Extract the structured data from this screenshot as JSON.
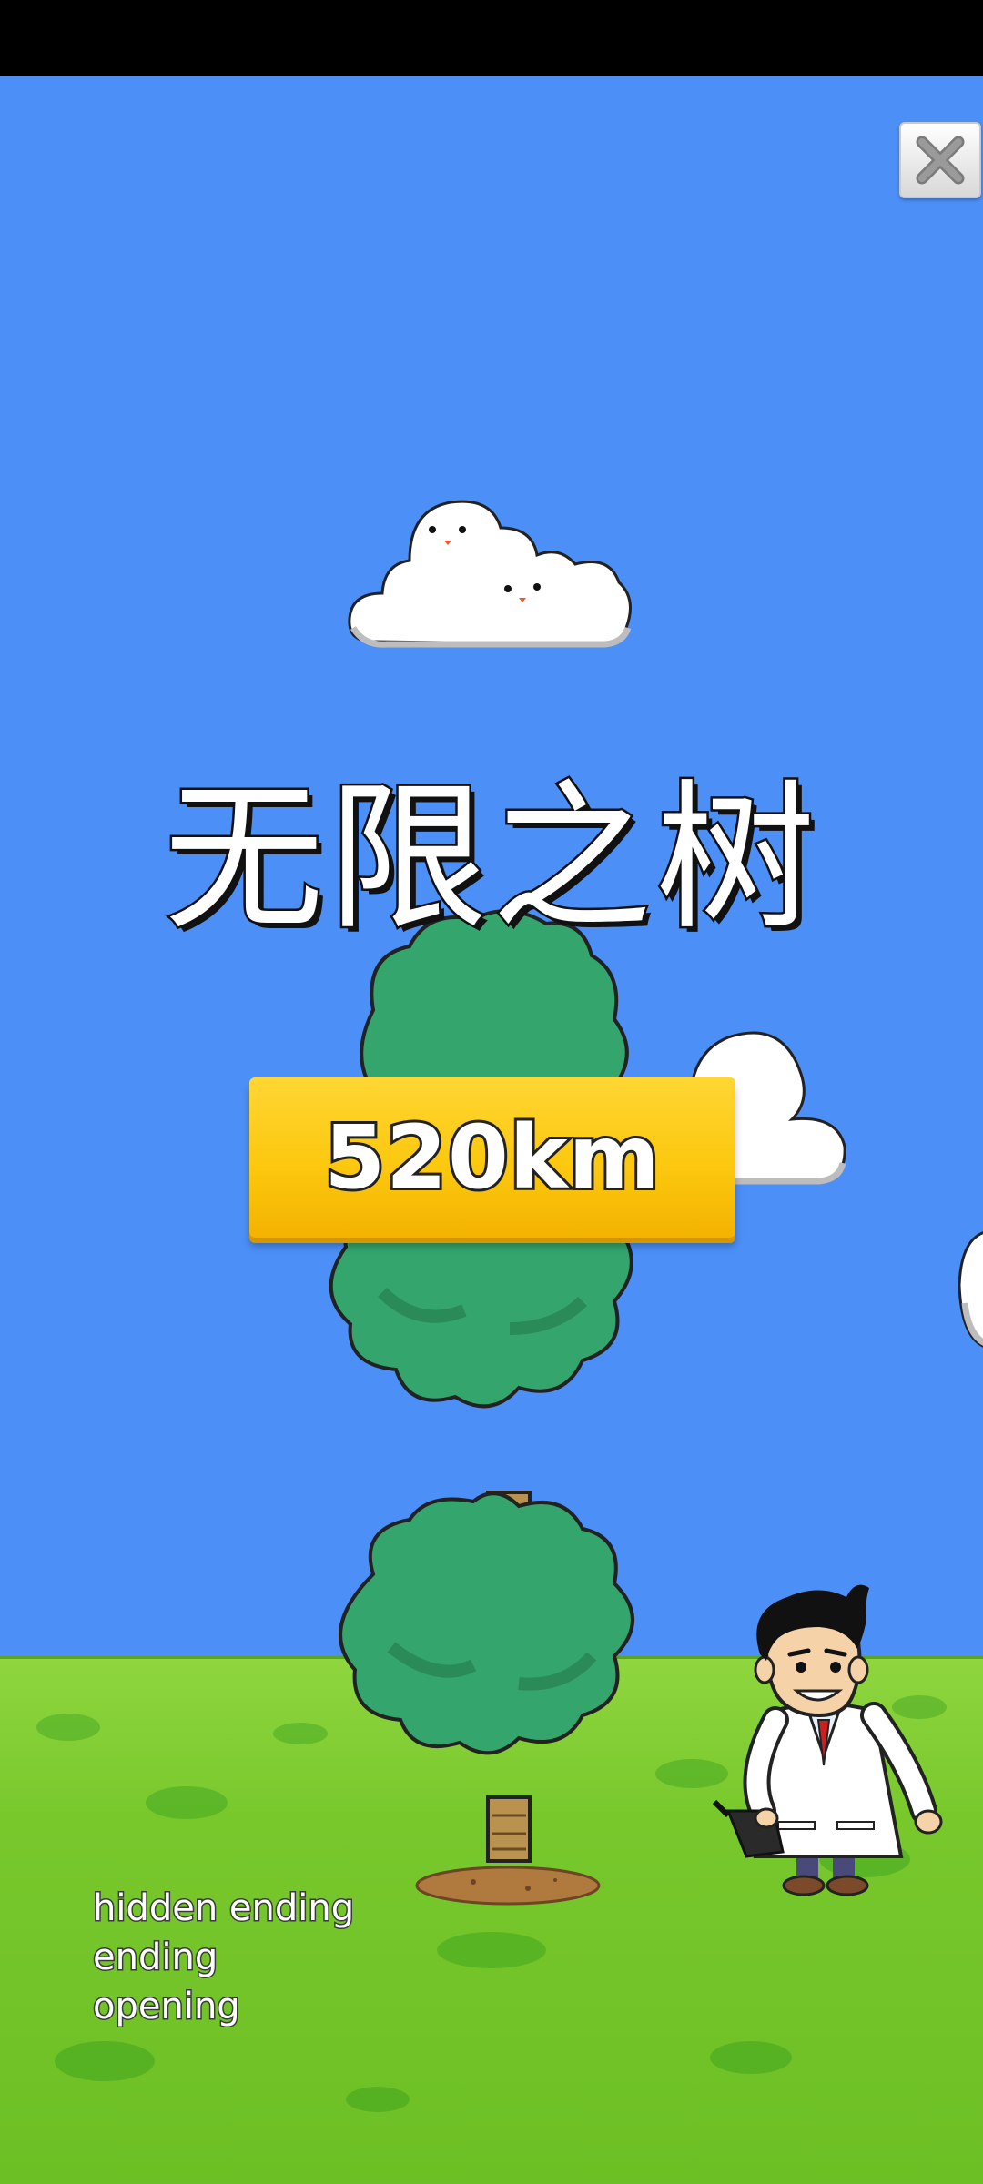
{
  "game": {
    "title": "无限之树",
    "distance": "520km"
  },
  "menu": {
    "items": [
      {
        "label": "hidden ending"
      },
      {
        "label": "ending"
      },
      {
        "label": "opening"
      }
    ]
  },
  "colors": {
    "sky": "#4b8ff7",
    "grass": "#78c82c",
    "badge": "#fcc80f",
    "foliage": "#34a56d"
  },
  "icons": {
    "close": "close-icon"
  }
}
